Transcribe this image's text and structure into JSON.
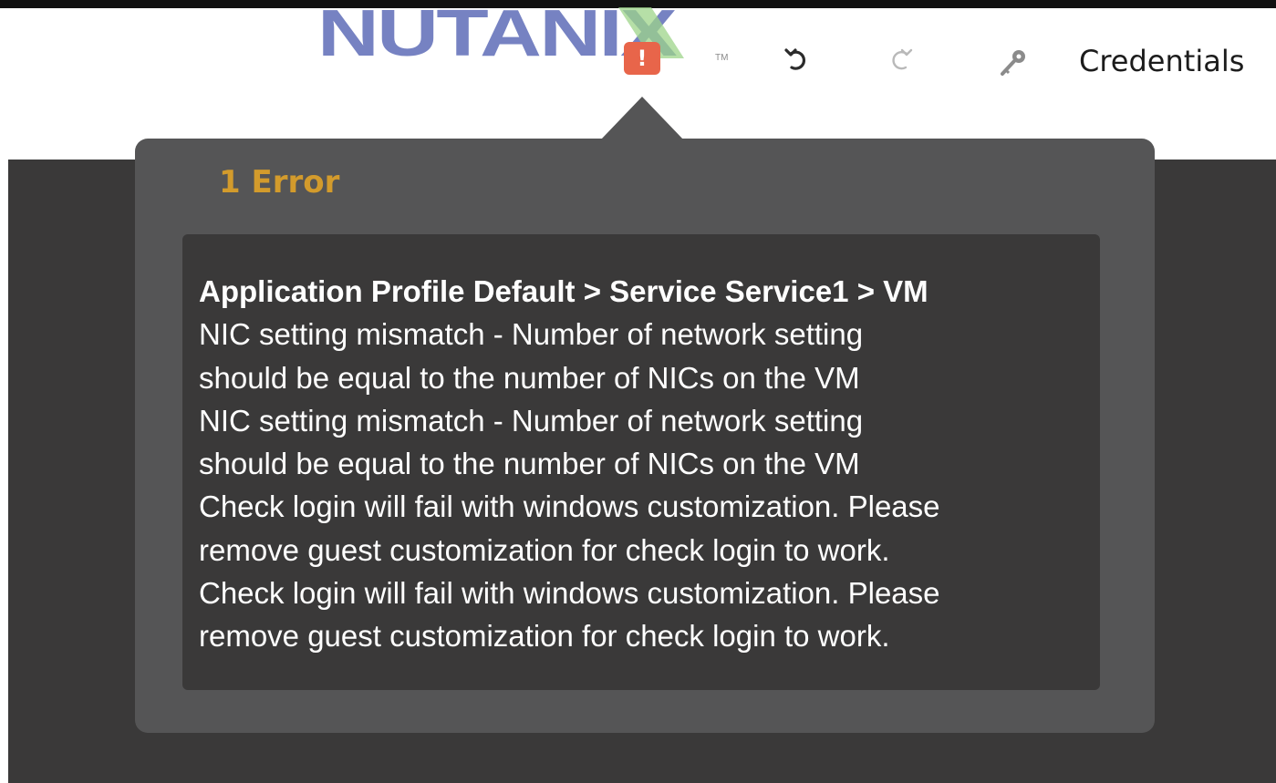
{
  "header": {
    "logo_text": "NUTANIX",
    "logo_tm": "TM",
    "error_indicator": "!",
    "credentials_label": "Credentials"
  },
  "icons": {
    "undo": "undo-icon",
    "redo": "redo-icon",
    "key": "key-icon"
  },
  "popover": {
    "title": "1 Error",
    "lines": [
      "Application Profile Default > Service Service1 > VM",
      "NIC setting mismatch - Number of network setting",
      "should be equal to the number of NICs on the VM",
      "NIC setting mismatch - Number of network setting",
      "should be equal to the number of NICs on the VM",
      "Check login will fail with windows customization. Please",
      "remove guest customization for check login to work.",
      "Check login will fail with windows customization. Please",
      "remove guest customization for check login to work."
    ]
  },
  "colors": {
    "logo_blue": "#6f7bbf",
    "logo_green": "#9dd48a",
    "error_accent": "#e8654a",
    "title_gold": "#d39b2c",
    "popover_bg": "#555556",
    "page_dark": "#3a3939"
  }
}
